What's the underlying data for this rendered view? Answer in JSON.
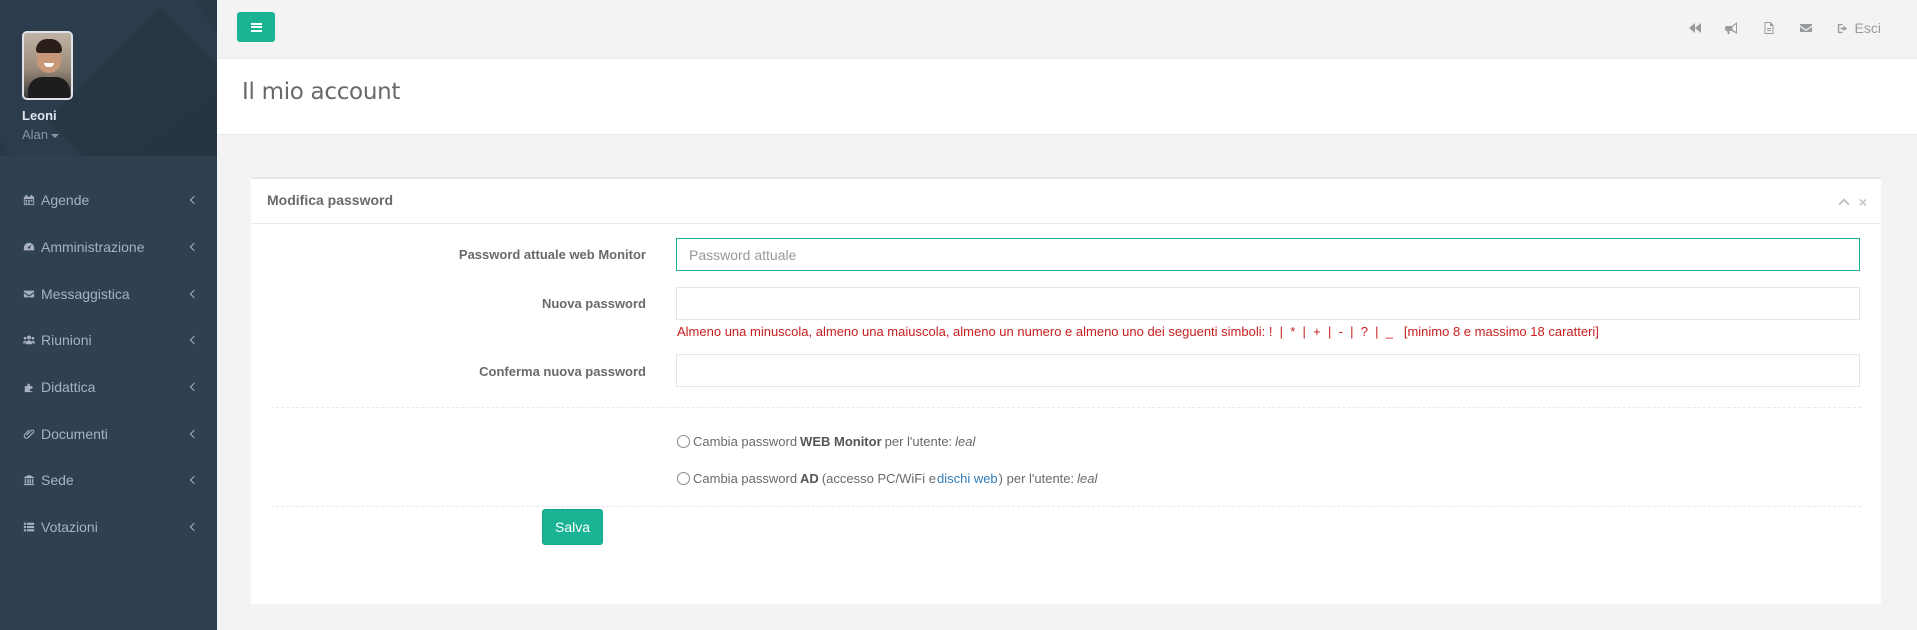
{
  "profile": {
    "surname": "Leoni",
    "name": "Alan"
  },
  "nav": [
    {
      "label": "Agende",
      "icon": "calendar-icon"
    },
    {
      "label": "Amministrazione",
      "icon": "dashboard-icon"
    },
    {
      "label": "Messaggistica",
      "icon": "envelope-icon"
    },
    {
      "label": "Riunioni",
      "icon": "users-icon"
    },
    {
      "label": "Didattica",
      "icon": "puzzle-icon"
    },
    {
      "label": "Documenti",
      "icon": "paperclip-icon"
    },
    {
      "label": "Sede",
      "icon": "institution-icon"
    },
    {
      "label": "Votazioni",
      "icon": "list-icon"
    }
  ],
  "topbar": {
    "logout_label": "Esci"
  },
  "page": {
    "title": "Il mio account"
  },
  "box": {
    "title": "Modifica password",
    "current_label": "Password attuale web Monitor",
    "current_placeholder": "Password attuale",
    "new_label": "Nuova password",
    "hint": "Almeno una minuscola, almeno una maiuscola, almeno un numero e almeno uno dei seguenti simboli: !  |  *  |  +  |  -  |  ?  |  _   [minimo 8 e massimo 18 caratteri]",
    "confirm_label": "Conferma nuova password",
    "radio1": {
      "pre": "Cambia password",
      "bold": "WEB Monitor",
      "post": "per l'utente:",
      "user": "leal"
    },
    "radio2": {
      "pre": "Cambia password",
      "bold": "AD",
      "mid": "(accesso PC/WiFi e",
      "link": "dischi web",
      "post": ") per l'utente:",
      "user": "leal"
    },
    "save_label": "Salva"
  },
  "colors": {
    "accent": "#1ab394",
    "sidebar": "#2f4050",
    "error": "#c81e1e",
    "link": "#337ab7"
  }
}
